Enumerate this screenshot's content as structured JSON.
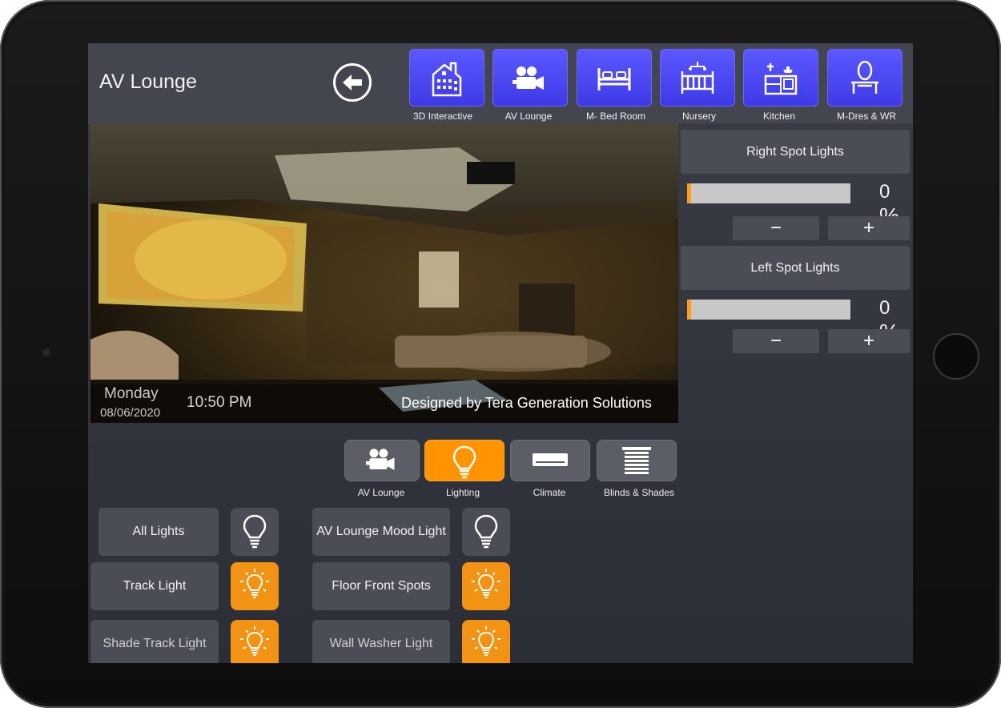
{
  "header": {
    "title": "AV Lounge"
  },
  "rooms": [
    {
      "label": "3D Interactive",
      "icon": "building-icon"
    },
    {
      "label": "AV Lounge",
      "icon": "video-camera-icon"
    },
    {
      "label": "M- Bed Room",
      "icon": "bed-icon"
    },
    {
      "label": "Nursery",
      "icon": "crib-icon"
    },
    {
      "label": "Kitchen",
      "icon": "kitchen-icon"
    },
    {
      "label": "M-Dres & WR",
      "icon": "vanity-icon"
    }
  ],
  "photo": {
    "day": "Monday",
    "date": "08/06/2020",
    "time": "10:50 PM",
    "credit": "Designed by Tera Generation Solutions"
  },
  "dimmers": [
    {
      "label": "Right Spot Lights",
      "level_percent": 0,
      "pct_text": "0",
      "pct_sign": "%",
      "minus": "−",
      "plus": "+"
    },
    {
      "label": "Left Spot Lights",
      "level_percent": 0,
      "pct_text": "0",
      "pct_sign": "%",
      "minus": "−",
      "plus": "+"
    }
  ],
  "categories": [
    {
      "label": "AV Lounge",
      "icon": "video-camera-icon",
      "active": false
    },
    {
      "label": "Lighting",
      "icon": "light-bulb-icon",
      "active": true
    },
    {
      "label": "Climate",
      "icon": "air-conditioner-icon",
      "active": false
    },
    {
      "label": "Blinds & Shades",
      "icon": "blinds-icon",
      "active": false
    }
  ],
  "lights": [
    {
      "label": "All Lights",
      "on": false
    },
    {
      "label": "AV Lounge Mood Light",
      "on": false
    },
    {
      "label": "Track Light",
      "on": true
    },
    {
      "label": "Floor Front Spots",
      "on": true
    },
    {
      "label": "Shade Track Light",
      "on": true
    },
    {
      "label": "Wall Washer Light",
      "on": true
    }
  ],
  "colors": {
    "room_tab": "#4b47f5",
    "active_category": "#ff9300",
    "light_on": "#f29313",
    "panel": "#4a4d55"
  }
}
